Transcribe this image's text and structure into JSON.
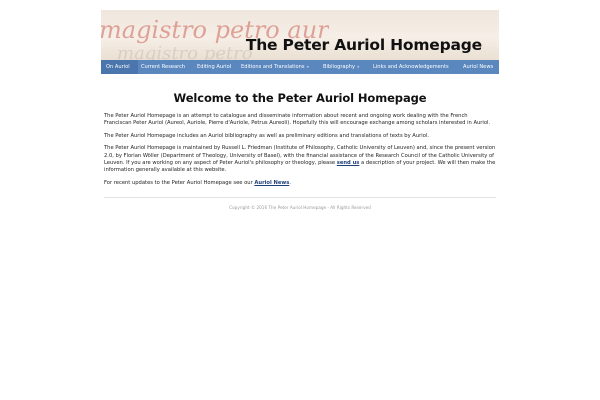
{
  "header": {
    "title": "The Peter Auriol Homepage",
    "banner_script_text": "magistro petro aurioli",
    "banner_colors": {
      "parchment": "#efe6dc",
      "ink_red": "#c4463a"
    }
  },
  "nav": {
    "background": "#5b87bf",
    "items": [
      {
        "label": "On Auriol",
        "has_dropdown": false
      },
      {
        "label": "Current Research",
        "has_dropdown": false
      },
      {
        "label": "Editing Auriol",
        "has_dropdown": false
      },
      {
        "label": "Editions and Translations",
        "has_dropdown": true
      },
      {
        "label": "Bibliography",
        "has_dropdown": true
      },
      {
        "label": "Links and Acknowledgements",
        "has_dropdown": false
      },
      {
        "label": "Auriol News",
        "has_dropdown": false
      }
    ],
    "dropdown_glyph": "»"
  },
  "main": {
    "heading": "Welcome to the Peter Auriol Homepage",
    "p1": "The Peter Auriol Homepage is an attempt to catalogue and disseminate information about recent and ongoing work dealing with the French Franciscan Peter Auriol (Aureol, Auriole, Pierre d'Auriole, Petrus Aureoli). Hopefully this will encourage exchange among scholars interested in Auriol.",
    "p2": "The Peter Auriol Homepage includes an Auriol bibliography as well as preliminary editions and translations of texts by Auriol.",
    "p3_before": "The Peter Auriol Homepage is maintained by Russell L. Friedman (Institute of Philosophy, Catholic University of Leuven) and, since the present version 2.0, by Florian Wöller (Department of Theology, University of Basel), with the financial assistance of the Research Council of the Catholic University of Leuven. If you are working on any aspect of Peter Auriol's philosophy or theology, please ",
    "p3_link": "send us",
    "p3_after": " a description of your project. We will then make the information generally available at this website.",
    "p4_before": "For recent updates to the Peter Auriol Homepage see our ",
    "p4_link": "Auriol News",
    "p4_after": "."
  },
  "footer": {
    "copyright": "Copyright © 2016 The Peter Auriol Homepage - All Rights Reserved"
  }
}
